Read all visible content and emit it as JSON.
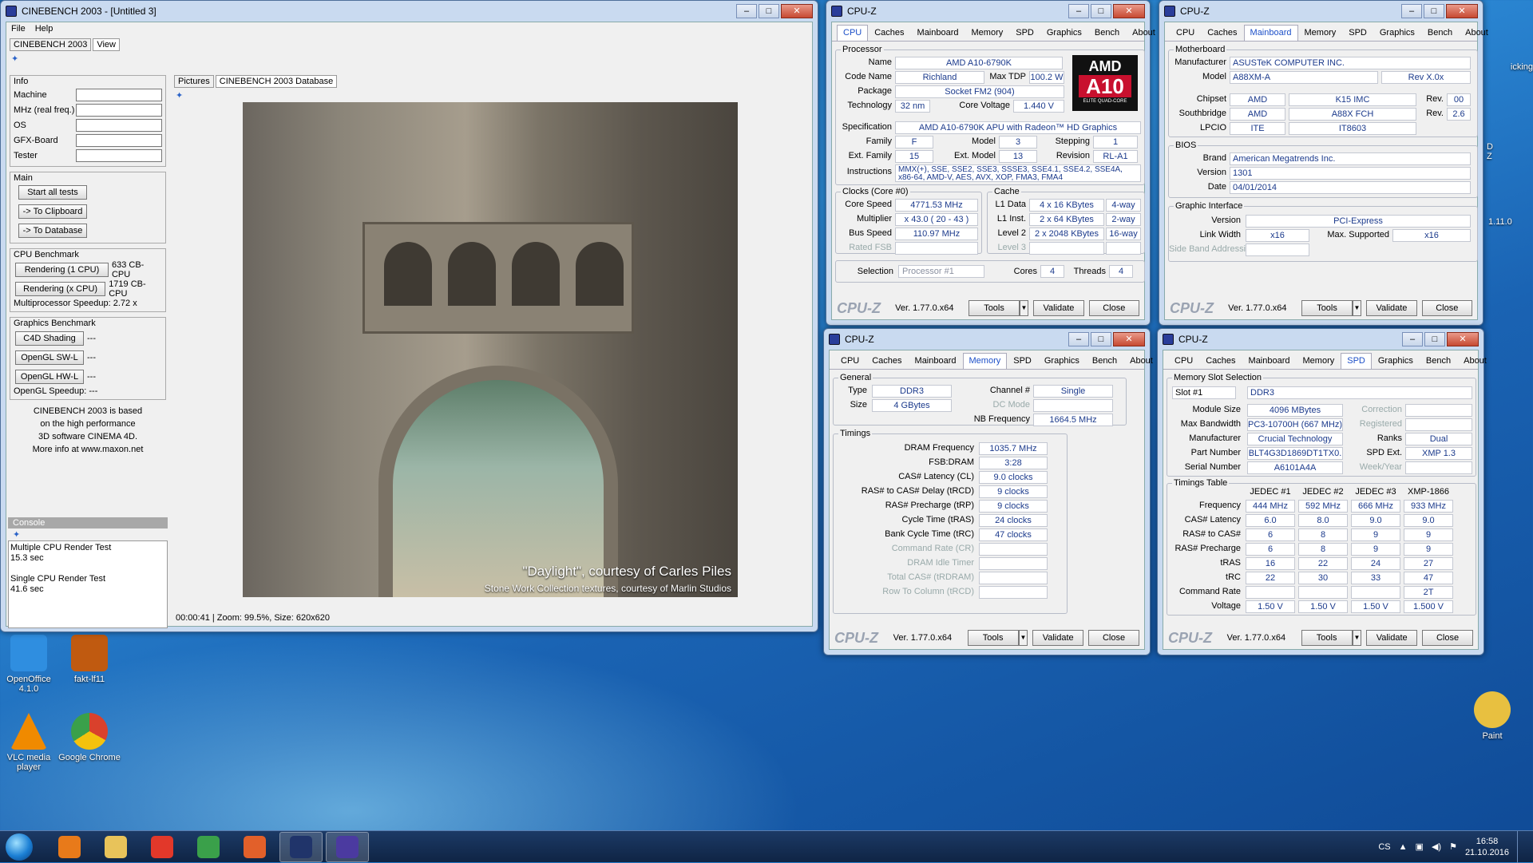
{
  "desktop": {
    "icons": [
      {
        "label": "OpenOffice 4.1.0",
        "color": "#2f8ee0"
      },
      {
        "label": "fakt-lf11",
        "color": "#c05a10"
      },
      {
        "label": "VLC media player",
        "color": "#f08a00"
      },
      {
        "label": "Google Chrome",
        "color": "#d9412c"
      },
      {
        "label": "Paint",
        "color": "#e8c040"
      }
    ],
    "partial_right": [
      "icking",
      "D",
      "Z",
      "1.11.0"
    ]
  },
  "cinebench": {
    "title": "CINEBENCH 2003 - [Untitled 3]",
    "menu": [
      "File",
      "Help"
    ],
    "tabs": [
      "CINEBENCH 2003",
      "View"
    ],
    "info": {
      "group": "Info",
      "fields": [
        "Machine",
        "MHz (real freq.)",
        "OS",
        "GFX-Board",
        "Tester"
      ]
    },
    "main": {
      "group": "Main",
      "buttons": [
        "Start all tests",
        "-> To Clipboard",
        "-> To Database"
      ]
    },
    "cpu": {
      "group": "CPU Benchmark",
      "r1": "Rendering (1 CPU)",
      "r1v": "633 CB-CPU",
      "rx": "Rendering (x CPU)",
      "rxv": "1719 CB-CPU",
      "speedup": "Multiprocessor Speedup: 2.72 x"
    },
    "gfx": {
      "group": "Graphics Benchmark",
      "items": [
        {
          "label": "C4D Shading",
          "value": "---"
        },
        {
          "label": "OpenGL SW-L",
          "value": "---"
        },
        {
          "label": "OpenGL HW-L",
          "value": "---"
        }
      ],
      "speedup": "OpenGL Speedup: ---"
    },
    "about": [
      "CINEBENCH 2003 is based",
      "on the high performance",
      "3D software CINEMA 4D.",
      "More info at www.maxon.net"
    ],
    "console": {
      "title": "Console",
      "lines": [
        "Multiple CPU Render Test",
        "15.3 sec",
        "",
        "Single CPU Render Test",
        "41.6 sec"
      ]
    },
    "picture_tabs": [
      "Pictures",
      "CINEBENCH 2003 Database"
    ],
    "caption1": "\"Daylight\", courtesy of Carles Piles",
    "caption2": "Stone Work Collection textures, courtesy of Marlin Studios",
    "status": "00:00:41  |  Zoom: 99.5%, Size: 620x620"
  },
  "cpuz_cpu": {
    "title": "CPU-Z",
    "tabs": [
      "CPU",
      "Caches",
      "Mainboard",
      "Memory",
      "SPD",
      "Graphics",
      "Bench",
      "About"
    ],
    "processor": {
      "legend": "Processor",
      "name": "AMD A10-6790K",
      "codename": "Richland",
      "maxtdp": "100.2 W",
      "package": "Socket FM2 (904)",
      "technology": "32 nm",
      "corevoltage": "1.440 V",
      "spec": "AMD A10-6790K APU with Radeon™ HD Graphics",
      "family": "F",
      "model": "3",
      "stepping": "1",
      "extfamily": "15",
      "extmodel": "13",
      "revision": "RL-A1",
      "instructions": "MMX(+), SSE, SSE2, SSE3, SSSE3, SSE4.1, SSE4.2, SSE4A, x86-64, AMD-V, AES, AVX, XOP, FMA3, FMA4"
    },
    "logo": {
      "brand": "AMD",
      "model": "A10",
      "sub": "ELITE QUAD-CORE"
    },
    "clocks": {
      "legend": "Clocks (Core #0)",
      "corespeed": "4771.53 MHz",
      "multiplier": "x 43.0 ( 20 - 43 )",
      "busspeed": "110.97 MHz",
      "ratedfsb": "Rated FSB"
    },
    "cache": {
      "legend": "Cache",
      "l1d": "4 x 16 KBytes",
      "l1dw": "4-way",
      "l1i": "2 x 64 KBytes",
      "l1iw": "2-way",
      "l2": "2 x 2048 KBytes",
      "l2w": "16-way",
      "l3": "Level 3"
    },
    "selection": "Processor #1",
    "cores": "4",
    "threads": "4",
    "labels": {
      "name": "Name",
      "codename": "Code Name",
      "maxtdp": "Max TDP",
      "package": "Package",
      "technology": "Technology",
      "corevoltage": "Core Voltage",
      "spec": "Specification",
      "family": "Family",
      "model": "Model",
      "stepping": "Stepping",
      "extfamily": "Ext. Family",
      "extmodel": "Ext. Model",
      "revision": "Revision",
      "instructions": "Instructions",
      "corespeed": "Core Speed",
      "multiplier": "Multiplier",
      "busspeed": "Bus Speed",
      "l1d": "L1 Data",
      "l1i": "L1 Inst.",
      "l2": "Level 2",
      "selection": "Selection",
      "cores": "Cores",
      "threads": "Threads"
    }
  },
  "cpuz_mb": {
    "title": "CPU-Z",
    "tabs": [
      "CPU",
      "Caches",
      "Mainboard",
      "Memory",
      "SPD",
      "Graphics",
      "Bench",
      "About"
    ],
    "motherboard": {
      "legend": "Motherboard",
      "manufacturer": "ASUSTeK COMPUTER INC.",
      "model": "A88XM-A",
      "rev": "Rev X.0x",
      "chipset_v": "AMD",
      "chipset": "K15 IMC",
      "chipset_rev": "00",
      "sb_v": "AMD",
      "sb": "A88X FCH",
      "sb_rev": "2.6",
      "lpcio_v": "ITE",
      "lpcio": "IT8603"
    },
    "bios": {
      "legend": "BIOS",
      "brand": "American Megatrends Inc.",
      "version": "1301",
      "date": "04/01/2014"
    },
    "gi": {
      "legend": "Graphic Interface",
      "version": "PCI-Express",
      "linkwidth": "x16",
      "maxsupported": "x16",
      "sideband": "Side Band Addressing"
    },
    "labels": {
      "manufacturer": "Manufacturer",
      "model": "Model",
      "chipset": "Chipset",
      "southbridge": "Southbridge",
      "lpcio": "LPCIO",
      "rev": "Rev.",
      "brand": "Brand",
      "version": "Version",
      "date": "Date",
      "linkwidth": "Link Width",
      "maxsupported": "Max. Supported"
    }
  },
  "cpuz_mem": {
    "title": "CPU-Z",
    "tabs": [
      "CPU",
      "Caches",
      "Mainboard",
      "Memory",
      "SPD",
      "Graphics",
      "Bench",
      "About"
    ],
    "general": {
      "legend": "General",
      "type": "DDR3",
      "size": "4 GBytes",
      "channel": "Single",
      "dcmode": "DC Mode",
      "nbfreq": "1664.5 MHz"
    },
    "timings": {
      "legend": "Timings",
      "rows": [
        {
          "label": "DRAM Frequency",
          "value": "1035.7 MHz",
          "active": true
        },
        {
          "label": "FSB:DRAM",
          "value": "3:28",
          "active": true
        },
        {
          "label": "CAS# Latency (CL)",
          "value": "9.0 clocks",
          "active": true
        },
        {
          "label": "RAS# to CAS# Delay (tRCD)",
          "value": "9 clocks",
          "active": true
        },
        {
          "label": "RAS# Precharge (tRP)",
          "value": "9 clocks",
          "active": true
        },
        {
          "label": "Cycle Time (tRAS)",
          "value": "24 clocks",
          "active": true
        },
        {
          "label": "Bank Cycle Time (tRC)",
          "value": "47 clocks",
          "active": true
        },
        {
          "label": "Command Rate (CR)",
          "value": "",
          "active": false
        },
        {
          "label": "DRAM Idle Timer",
          "value": "",
          "active": false
        },
        {
          "label": "Total CAS# (tRDRAM)",
          "value": "",
          "active": false
        },
        {
          "label": "Row To Column (tRCD)",
          "value": "",
          "active": false
        }
      ]
    },
    "labels": {
      "type": "Type",
      "size": "Size",
      "channel": "Channel #",
      "nbfreq": "NB Frequency"
    }
  },
  "cpuz_spd": {
    "title": "CPU-Z",
    "tabs": [
      "CPU",
      "Caches",
      "Mainboard",
      "Memory",
      "SPD",
      "Graphics",
      "Bench",
      "About"
    ],
    "slot": {
      "legend": "Memory Slot Selection",
      "slot": "Slot #1",
      "type": "DDR3",
      "modulesize": "4096 MBytes",
      "maxbw": "PC3-10700H (667 MHz)",
      "manufacturer": "Crucial Technology",
      "partnumber": "BLT4G3D1869DT1TX0.",
      "serial": "A6101A4A",
      "correction": "Correction",
      "registered": "Registered",
      "ranks": "Dual",
      "spdext": "XMP 1.3",
      "weekyear": "Week/Year"
    },
    "table": {
      "legend": "Timings Table",
      "headers": [
        "JEDEC #1",
        "JEDEC #2",
        "JEDEC #3",
        "XMP-1866"
      ],
      "rows": [
        {
          "label": "Frequency",
          "values": [
            "444 MHz",
            "592 MHz",
            "666 MHz",
            "933 MHz"
          ]
        },
        {
          "label": "CAS# Latency",
          "values": [
            "6.0",
            "8.0",
            "9.0",
            "9.0"
          ]
        },
        {
          "label": "RAS# to CAS#",
          "values": [
            "6",
            "8",
            "9",
            "9"
          ]
        },
        {
          "label": "RAS# Precharge",
          "values": [
            "6",
            "8",
            "9",
            "9"
          ]
        },
        {
          "label": "tRAS",
          "values": [
            "16",
            "22",
            "24",
            "27"
          ]
        },
        {
          "label": "tRC",
          "values": [
            "22",
            "30",
            "33",
            "47"
          ]
        },
        {
          "label": "Command Rate",
          "values": [
            "",
            "",
            "",
            "2T"
          ]
        },
        {
          "label": "Voltage",
          "values": [
            "1.50 V",
            "1.50 V",
            "1.50 V",
            "1.500 V"
          ]
        }
      ]
    },
    "labels": {
      "modulesize": "Module Size",
      "maxbw": "Max Bandwidth",
      "manufacturer": "Manufacturer",
      "partnumber": "Part Number",
      "serial": "Serial Number",
      "ranks": "Ranks",
      "spdext": "SPD Ext."
    }
  },
  "footer": {
    "logo": "CPU-Z",
    "version": "Ver. 1.77.0.x64",
    "tools": "Tools",
    "validate": "Validate",
    "close": "Close"
  },
  "taskbar": {
    "items": [
      {
        "name": "media-player",
        "color": "#e87a1a"
      },
      {
        "name": "explorer",
        "color": "#e8c35a"
      },
      {
        "name": "app-red",
        "color": "#e2382a"
      },
      {
        "name": "chrome",
        "color": "#3aa04a"
      },
      {
        "name": "firefox",
        "color": "#e2602a"
      },
      {
        "name": "cinebench",
        "color": "#20346a"
      },
      {
        "name": "cpu-z",
        "color": "#4b3aa0"
      }
    ],
    "lang": "CS",
    "time": "16:58",
    "date": "21.10.2016"
  }
}
